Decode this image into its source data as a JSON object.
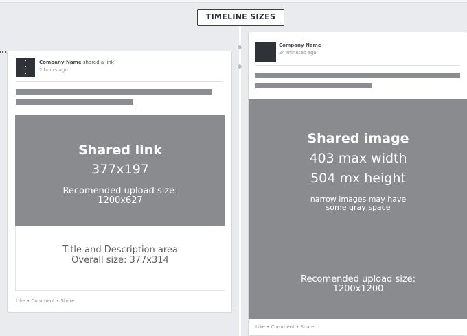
{
  "header": {
    "title": "TIMELINE SIZES"
  },
  "left_post": {
    "company_name": "Company Name",
    "action": "shared a link",
    "time": "2 hours ago",
    "block_title": "Shared link",
    "block_size": "377x197",
    "upload_label": "Recomended upload size:",
    "upload_size": "1200x627",
    "desc_title": "Title and Description area",
    "desc_size": "Overall size: 377x314",
    "footer": "Like • Comment • Share"
  },
  "right_post": {
    "company_name": "Company Name",
    "time": "24 minutes ago",
    "block_title": "Shared image",
    "max_width": "403 max width",
    "max_height": "504 mx height",
    "note_line1": "narrow images may have",
    "note_line2": "some gray space",
    "upload_label": "Recomended upload size:",
    "upload_size": "1200x1200",
    "footer": "Like • Comment • Share"
  }
}
